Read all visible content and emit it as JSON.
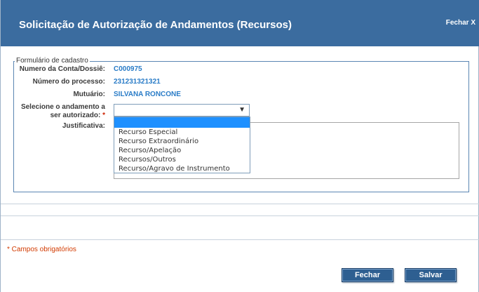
{
  "dialog": {
    "title": "Solicitação de Autorização de Andamentos (Recursos)",
    "close_link": "Fechar X"
  },
  "form": {
    "legend": "Formulário de cadastro",
    "fields": {
      "conta": {
        "label": "Numero da Conta/Dossiê:",
        "value": "C000975"
      },
      "processo": {
        "label": "Número do processo:",
        "value": "231231321321"
      },
      "mutuario": {
        "label": "Mutuário:",
        "value": "SILVANA RONCONE"
      },
      "andamento": {
        "label": "Selecione o andamento a ser autorizado:",
        "required_mark": "*",
        "selected": ""
      },
      "justificativa": {
        "label": "Justificativa:",
        "value": ""
      }
    },
    "andamento_options": [
      "",
      "Recurso Especial",
      "Recurso Extraordinário",
      "Recurso/Apelação",
      "Recursos/Outros",
      "Recurso/Agravo de Instrumento"
    ]
  },
  "footer": {
    "required_note": "* Campos obrigatórios",
    "close_button": "Fechar",
    "save_button": "Salvar"
  },
  "colors": {
    "titlebar": "#3b6c9f",
    "value_text": "#2a7cc7",
    "required_text": "#d23a00",
    "button": "#2e5f91"
  }
}
